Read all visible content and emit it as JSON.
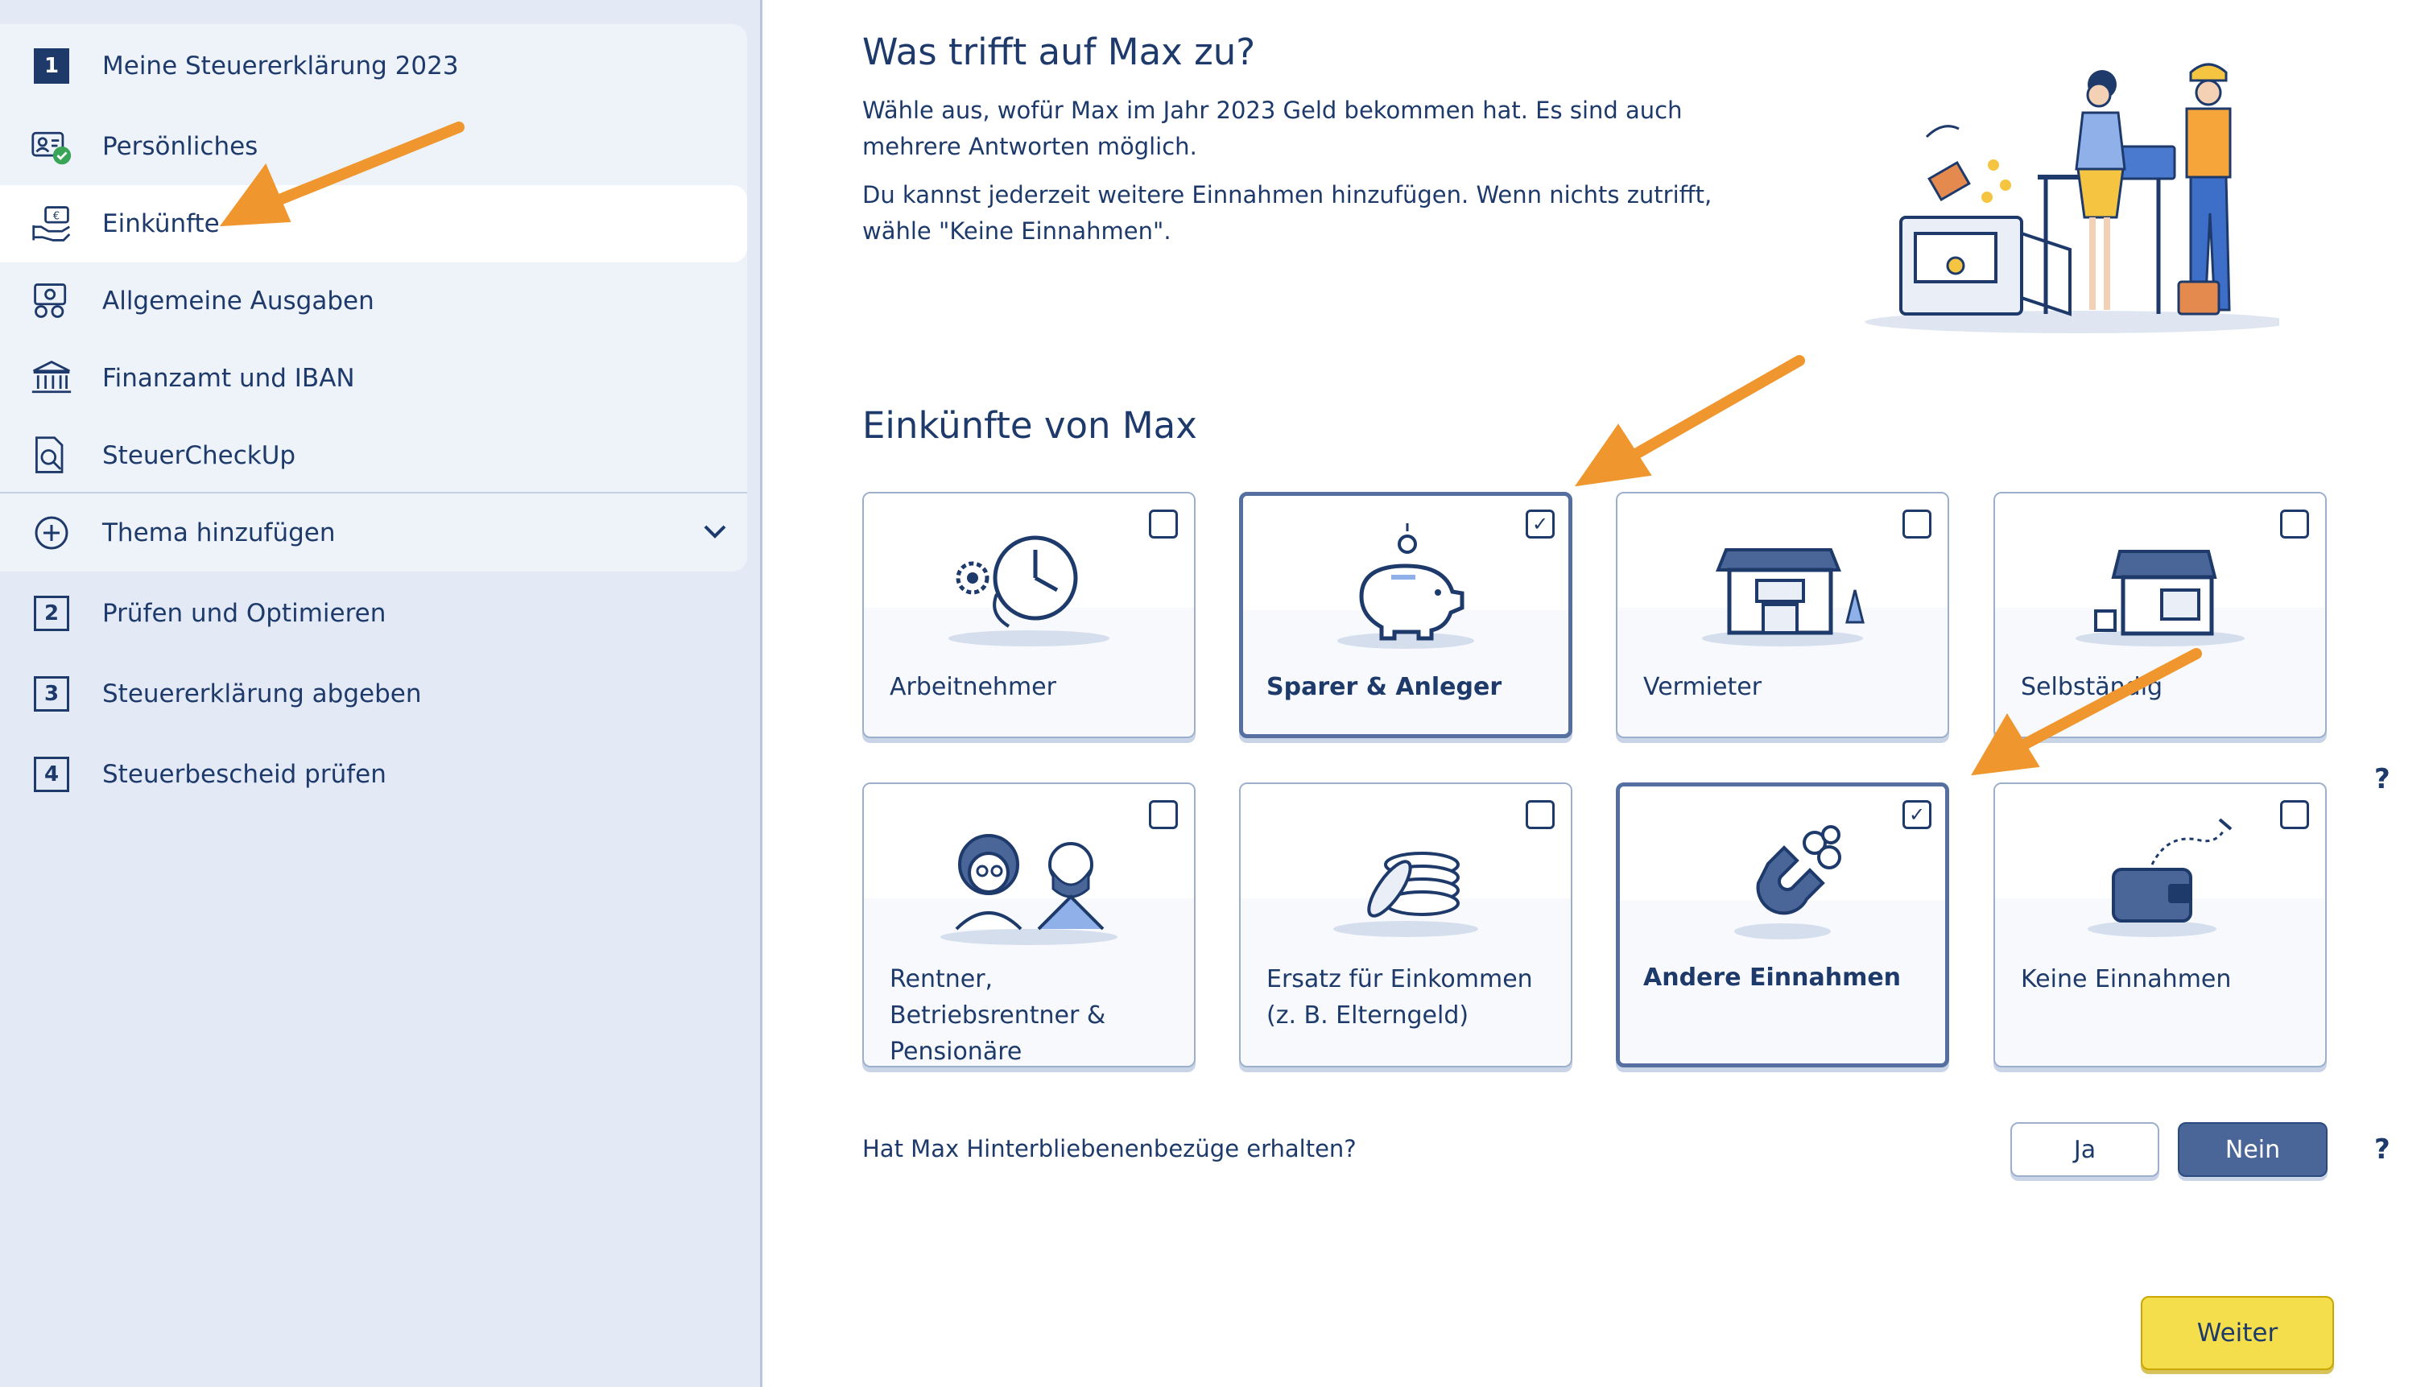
{
  "sidebar": {
    "items": [
      {
        "number": "1",
        "label": "Meine Steuererklärung 2023"
      },
      {
        "label": "Persönliches"
      },
      {
        "label": "Einkünfte"
      },
      {
        "label": "Allgemeine Ausgaben"
      },
      {
        "label": "Finanzamt und IBAN"
      },
      {
        "label": "SteuerCheckUp"
      },
      {
        "label": "Thema hinzufügen"
      },
      {
        "number": "2",
        "label": "Prüfen und Optimieren"
      },
      {
        "number": "3",
        "label": "Steuererklärung abgeben"
      },
      {
        "number": "4",
        "label": "Steuerbescheid prüfen"
      }
    ],
    "active_item": "Einkünfte"
  },
  "main": {
    "title": "Was trifft auf Max zu?",
    "intro_1": "Wähle aus, wofür Max im Jahr 2023 Geld bekommen hat. Es sind auch mehrere Antworten möglich.",
    "intro_2": "Du kannst jederzeit weitere Einnahmen hinzufügen. Wenn nichts zutrifft, wähle \"Keine Einnahmen\".",
    "section_title": "Einkünfte von Max",
    "cards": [
      {
        "label": "Arbeitnehmer",
        "checked": false,
        "icon": "clock-gear-icon"
      },
      {
        "label": "Sparer & Anleger",
        "checked": true,
        "icon": "piggy-bank-icon"
      },
      {
        "label": "Vermieter",
        "checked": false,
        "icon": "house-icon"
      },
      {
        "label": "Selbständig",
        "checked": false,
        "icon": "shop-icon"
      },
      {
        "label": "Rentner, Betriebsrentner & Pensionäre",
        "checked": false,
        "icon": "elderly-couple-icon"
      },
      {
        "label": "Ersatz für Einkommen (z. B. Elterngeld)",
        "checked": false,
        "icon": "coin-stack-icon"
      },
      {
        "label": "Andere Einnahmen",
        "checked": true,
        "icon": "magnet-icon"
      },
      {
        "label": "Keine Einnahmen",
        "checked": false,
        "icon": "empty-wallet-icon"
      }
    ],
    "checkmark": "✓",
    "question": "Hat Max Hinterbliebenenbezüge erhalten?",
    "answer_yes": "Ja",
    "answer_no": "Nein",
    "selected_answer": "Nein",
    "help_symbol": "?",
    "next_button": "Weiter"
  },
  "colors": {
    "primary": "#1d3a6b",
    "sidebar_bg": "#e3eaf5",
    "selected_button": "#4a6598",
    "next_button": "#f5de4c",
    "annotation_arrow": "#f0962e"
  }
}
